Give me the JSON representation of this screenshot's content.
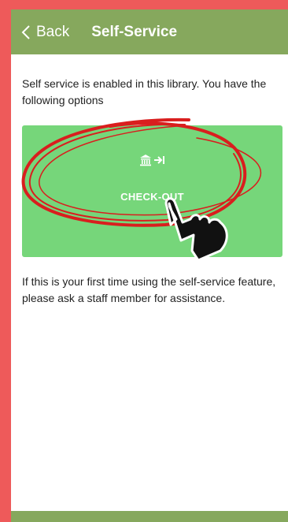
{
  "header": {
    "back_label": "Back",
    "title": "Self-Service"
  },
  "intro_text": "Self service is enabled in this library. You have the following options",
  "option": {
    "label": "CHECK-OUT",
    "icon": "library-checkout-icon"
  },
  "note_text": "If this is your first time using the self-service feature, please ask a staff member for assistance.",
  "overlay": {
    "annotation": "red-circle-highlight",
    "pointer": "pointing-hand-icon"
  },
  "colors": {
    "frame": "#ee5a5a",
    "header": "#86a85d",
    "card": "#76d67a",
    "annotation": "#d91e1e"
  }
}
